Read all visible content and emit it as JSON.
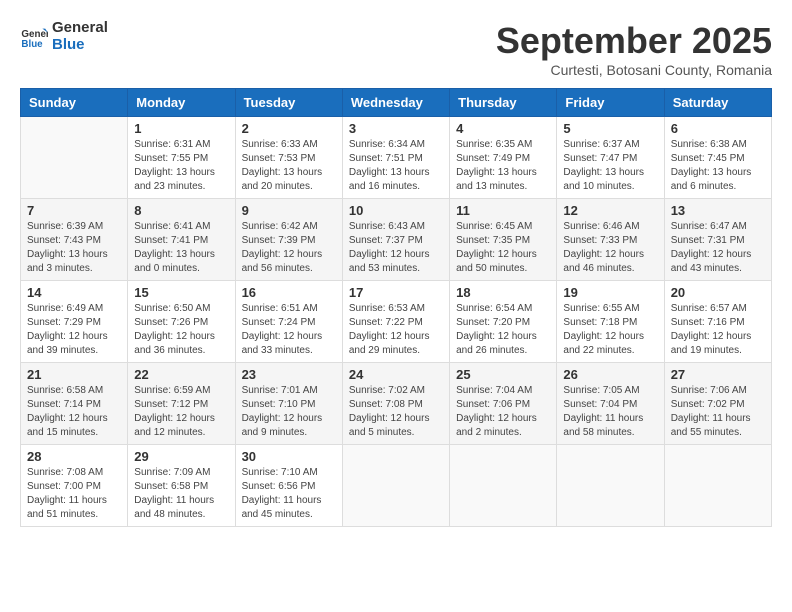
{
  "header": {
    "logo_general": "General",
    "logo_blue": "Blue",
    "month_title": "September 2025",
    "location": "Curtesti, Botosani County, Romania"
  },
  "weekdays": [
    "Sunday",
    "Monday",
    "Tuesday",
    "Wednesday",
    "Thursday",
    "Friday",
    "Saturday"
  ],
  "weeks": [
    {
      "shaded": false,
      "days": [
        {
          "num": "",
          "info": ""
        },
        {
          "num": "1",
          "info": "Sunrise: 6:31 AM\nSunset: 7:55 PM\nDaylight: 13 hours\nand 23 minutes."
        },
        {
          "num": "2",
          "info": "Sunrise: 6:33 AM\nSunset: 7:53 PM\nDaylight: 13 hours\nand 20 minutes."
        },
        {
          "num": "3",
          "info": "Sunrise: 6:34 AM\nSunset: 7:51 PM\nDaylight: 13 hours\nand 16 minutes."
        },
        {
          "num": "4",
          "info": "Sunrise: 6:35 AM\nSunset: 7:49 PM\nDaylight: 13 hours\nand 13 minutes."
        },
        {
          "num": "5",
          "info": "Sunrise: 6:37 AM\nSunset: 7:47 PM\nDaylight: 13 hours\nand 10 minutes."
        },
        {
          "num": "6",
          "info": "Sunrise: 6:38 AM\nSunset: 7:45 PM\nDaylight: 13 hours\nand 6 minutes."
        }
      ]
    },
    {
      "shaded": true,
      "days": [
        {
          "num": "7",
          "info": "Sunrise: 6:39 AM\nSunset: 7:43 PM\nDaylight: 13 hours\nand 3 minutes."
        },
        {
          "num": "8",
          "info": "Sunrise: 6:41 AM\nSunset: 7:41 PM\nDaylight: 13 hours\nand 0 minutes."
        },
        {
          "num": "9",
          "info": "Sunrise: 6:42 AM\nSunset: 7:39 PM\nDaylight: 12 hours\nand 56 minutes."
        },
        {
          "num": "10",
          "info": "Sunrise: 6:43 AM\nSunset: 7:37 PM\nDaylight: 12 hours\nand 53 minutes."
        },
        {
          "num": "11",
          "info": "Sunrise: 6:45 AM\nSunset: 7:35 PM\nDaylight: 12 hours\nand 50 minutes."
        },
        {
          "num": "12",
          "info": "Sunrise: 6:46 AM\nSunset: 7:33 PM\nDaylight: 12 hours\nand 46 minutes."
        },
        {
          "num": "13",
          "info": "Sunrise: 6:47 AM\nSunset: 7:31 PM\nDaylight: 12 hours\nand 43 minutes."
        }
      ]
    },
    {
      "shaded": false,
      "days": [
        {
          "num": "14",
          "info": "Sunrise: 6:49 AM\nSunset: 7:29 PM\nDaylight: 12 hours\nand 39 minutes."
        },
        {
          "num": "15",
          "info": "Sunrise: 6:50 AM\nSunset: 7:26 PM\nDaylight: 12 hours\nand 36 minutes."
        },
        {
          "num": "16",
          "info": "Sunrise: 6:51 AM\nSunset: 7:24 PM\nDaylight: 12 hours\nand 33 minutes."
        },
        {
          "num": "17",
          "info": "Sunrise: 6:53 AM\nSunset: 7:22 PM\nDaylight: 12 hours\nand 29 minutes."
        },
        {
          "num": "18",
          "info": "Sunrise: 6:54 AM\nSunset: 7:20 PM\nDaylight: 12 hours\nand 26 minutes."
        },
        {
          "num": "19",
          "info": "Sunrise: 6:55 AM\nSunset: 7:18 PM\nDaylight: 12 hours\nand 22 minutes."
        },
        {
          "num": "20",
          "info": "Sunrise: 6:57 AM\nSunset: 7:16 PM\nDaylight: 12 hours\nand 19 minutes."
        }
      ]
    },
    {
      "shaded": true,
      "days": [
        {
          "num": "21",
          "info": "Sunrise: 6:58 AM\nSunset: 7:14 PM\nDaylight: 12 hours\nand 15 minutes."
        },
        {
          "num": "22",
          "info": "Sunrise: 6:59 AM\nSunset: 7:12 PM\nDaylight: 12 hours\nand 12 minutes."
        },
        {
          "num": "23",
          "info": "Sunrise: 7:01 AM\nSunset: 7:10 PM\nDaylight: 12 hours\nand 9 minutes."
        },
        {
          "num": "24",
          "info": "Sunrise: 7:02 AM\nSunset: 7:08 PM\nDaylight: 12 hours\nand 5 minutes."
        },
        {
          "num": "25",
          "info": "Sunrise: 7:04 AM\nSunset: 7:06 PM\nDaylight: 12 hours\nand 2 minutes."
        },
        {
          "num": "26",
          "info": "Sunrise: 7:05 AM\nSunset: 7:04 PM\nDaylight: 11 hours\nand 58 minutes."
        },
        {
          "num": "27",
          "info": "Sunrise: 7:06 AM\nSunset: 7:02 PM\nDaylight: 11 hours\nand 55 minutes."
        }
      ]
    },
    {
      "shaded": false,
      "days": [
        {
          "num": "28",
          "info": "Sunrise: 7:08 AM\nSunset: 7:00 PM\nDaylight: 11 hours\nand 51 minutes."
        },
        {
          "num": "29",
          "info": "Sunrise: 7:09 AM\nSunset: 6:58 PM\nDaylight: 11 hours\nand 48 minutes."
        },
        {
          "num": "30",
          "info": "Sunrise: 7:10 AM\nSunset: 6:56 PM\nDaylight: 11 hours\nand 45 minutes."
        },
        {
          "num": "",
          "info": ""
        },
        {
          "num": "",
          "info": ""
        },
        {
          "num": "",
          "info": ""
        },
        {
          "num": "",
          "info": ""
        }
      ]
    }
  ]
}
